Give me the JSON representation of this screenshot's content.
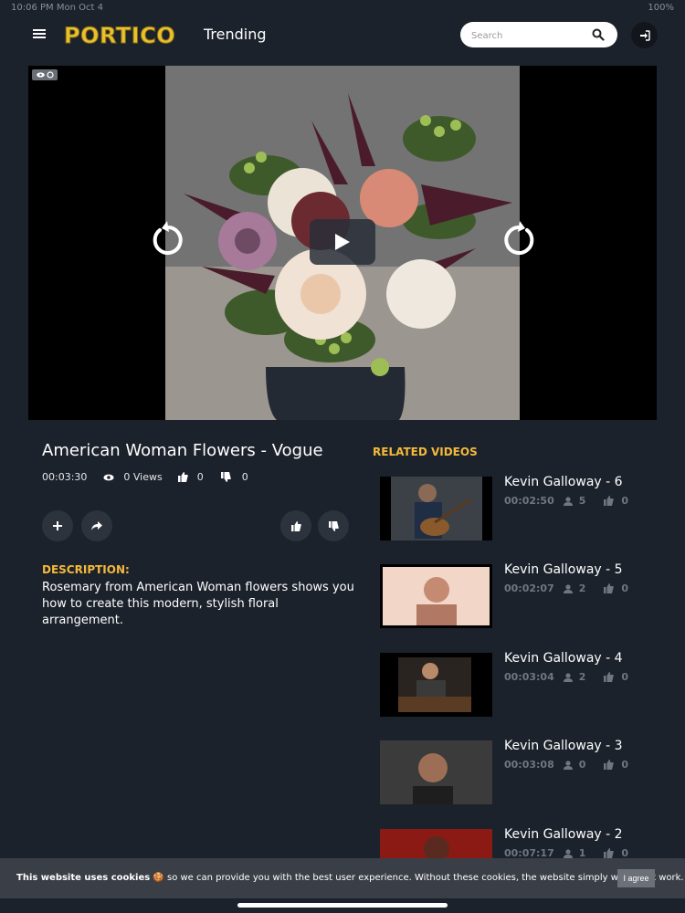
{
  "status_bar": {
    "left": "10:06 PM  Mon Oct 4",
    "right": "100%"
  },
  "header": {
    "logo": "PORTICO",
    "page_title": "Trending",
    "search_placeholder": "Search"
  },
  "video": {
    "title": "American Woman Flowers - Vogue",
    "duration": "00:03:30",
    "views": "0 Views",
    "likes": "0",
    "dislikes": "0",
    "description_heading": "DESCRIPTION:",
    "description": "Rosemary from American Woman flowers shows you how to create this modern, stylish floral arrangement."
  },
  "related": {
    "heading": "RELATED VIDEOS",
    "items": [
      {
        "title": "Kevin Galloway - 6",
        "duration": "00:02:50",
        "viewers": "5",
        "likes": "0"
      },
      {
        "title": "Kevin Galloway - 5",
        "duration": "00:02:07",
        "viewers": "2",
        "likes": "0"
      },
      {
        "title": "Kevin Galloway - 4",
        "duration": "00:03:04",
        "viewers": "2",
        "likes": "0"
      },
      {
        "title": "Kevin Galloway - 3",
        "duration": "00:03:08",
        "viewers": "0",
        "likes": "0"
      },
      {
        "title": "Kevin Galloway - 2",
        "duration": "00:07:17",
        "viewers": "1",
        "likes": "0"
      }
    ]
  },
  "cookie": {
    "bold": "This website uses cookies",
    "emoji": "🍪",
    "text": " so we can provide you with the best user experience. Without these cookies, the website simply would not work.",
    "agree_label": "I agree"
  },
  "colors": {
    "accent": "#f3b93a",
    "logo": "#e8c22e",
    "background": "#1c222c"
  }
}
